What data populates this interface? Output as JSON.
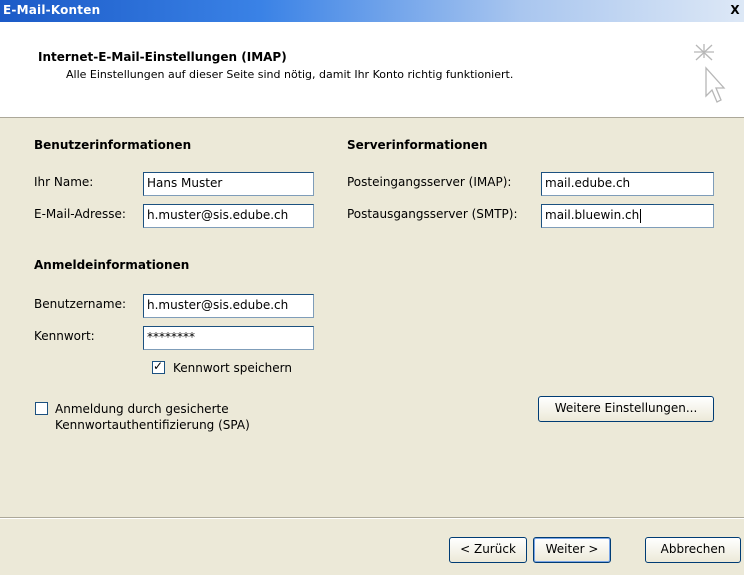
{
  "window": {
    "title": "E-Mail-Konten",
    "close_label": "X"
  },
  "header": {
    "title": "Internet-E-Mail-Einstellungen (IMAP)",
    "subtitle": "Alle Einstellungen auf dieser Seite sind nötig, damit Ihr Konto richtig funktioniert."
  },
  "user_info": {
    "heading": "Benutzerinformationen",
    "name_label": "Ihr Name:",
    "name_value": "Hans Muster",
    "email_label": "E-Mail-Adresse:",
    "email_value": "h.muster@sis.edube.ch"
  },
  "server_info": {
    "heading": "Serverinformationen",
    "incoming_label": "Posteingangsserver (IMAP):",
    "incoming_value": "mail.edube.ch",
    "outgoing_label": "Postausgangsserver (SMTP):",
    "outgoing_value": "mail.bluewin.ch"
  },
  "login_info": {
    "heading": "Anmeldeinformationen",
    "username_label": "Benutzername:",
    "username_value": "h.muster@sis.edube.ch",
    "password_label": "Kennwort:",
    "password_value": "********",
    "remember_label": "Kennwort speichern",
    "remember_checked": true
  },
  "spa": {
    "label_line1": "Anmeldung durch gesicherte",
    "label_line2": "Kennwortauthentifizierung (SPA)",
    "checked": false
  },
  "buttons": {
    "more_settings": "Weitere Einstellungen...",
    "back": "< Zurück",
    "next": "Weiter >",
    "cancel": "Abbrechen"
  },
  "colors": {
    "title_bar": "#1b5ac7",
    "dialog_bg": "#ece9d8",
    "field_border": "#7f9db9"
  }
}
